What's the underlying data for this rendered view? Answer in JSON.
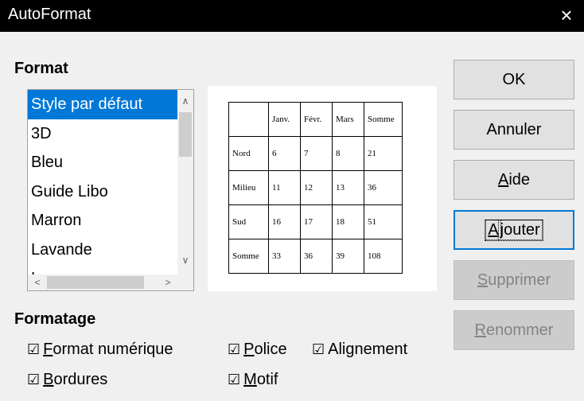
{
  "window": {
    "title": "AutoFormat"
  },
  "format_section": {
    "label": "Format",
    "styles": [
      "Style par défaut",
      "3D",
      "Bleu",
      "Guide Libo",
      "Marron",
      "Lavande",
      "L"
    ],
    "selected_index": 0
  },
  "preview": {
    "rows": [
      [
        "",
        "Janv.",
        "Févr.",
        "Mars",
        "Somme"
      ],
      [
        "Nord",
        "6",
        "7",
        "8",
        "21"
      ],
      [
        "Milieu",
        "11",
        "12",
        "13",
        "36"
      ],
      [
        "Sud",
        "16",
        "17",
        "18",
        "51"
      ],
      [
        "Somme",
        "33",
        "36",
        "39",
        "108"
      ]
    ]
  },
  "buttons": {
    "ok": {
      "label": "OK"
    },
    "cancel": {
      "label": "Annuler"
    },
    "help": {
      "mnemonic": "A",
      "rest": "ide"
    },
    "add": {
      "mnemonic": "A",
      "rest": "jouter"
    },
    "delete": {
      "mnemonic": "S",
      "rest": "upprimer"
    },
    "rename": {
      "mnemonic": "R",
      "rest": "enommer"
    }
  },
  "formatting_section": {
    "label": "Formatage",
    "checkbox_glyph": "☑",
    "number_format": {
      "mnemonic": "F",
      "rest": "ormat numérique"
    },
    "font": {
      "mnemonic": "P",
      "rest": "olice"
    },
    "alignment": {
      "before": "Ali",
      "mnemonic": "g",
      "rest": "nement"
    },
    "borders": {
      "mnemonic": "B",
      "rest": "ordures"
    },
    "pattern": {
      "mnemonic": "M",
      "rest": "otif"
    }
  },
  "icons": {
    "close": "×",
    "scroll_up": "∧",
    "scroll_down": "∨",
    "scroll_left": "<",
    "scroll_right": ">"
  },
  "colors": {
    "selection": "#0078d7",
    "titlebar": "#000000",
    "focus": "#0078d7"
  }
}
